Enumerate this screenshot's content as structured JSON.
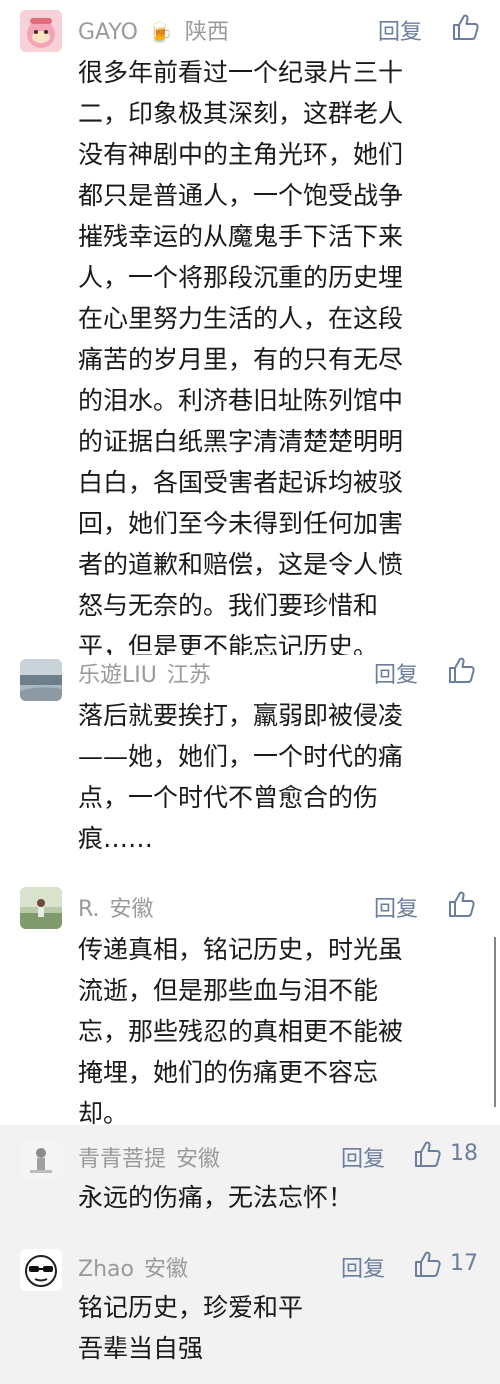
{
  "comments": [
    {
      "nickname": "GAYO",
      "badge": "🍺",
      "location": "陕西",
      "reply_label": "回复",
      "likes": "",
      "lines": [
        "很多年前看过一个纪录片三十",
        "二，印象极其深刻，这群老人",
        "没有神剧中的主角光环，她们",
        "都只是普通人，一个饱受战争",
        "摧残幸运的从魔鬼手下活下来",
        "人，一个将那段沉重的历史埋",
        "在心里努力生活的人，在这段",
        "痛苦的岁月里，有的只有无尽",
        "的泪水。利济巷旧址陈列馆中",
        "的证据白纸黑字清清楚楚明明",
        "白白，各国受害者起诉均被驳",
        "回，她们至今未得到任何加害",
        "者的道歉和赔偿，这是令人愤",
        "怒与无奈的。我们要珍惜和",
        "平，但是更不能忘记历史。"
      ]
    },
    {
      "nickname": "乐遊LIU",
      "location": "江苏",
      "reply_label": "回复",
      "likes": "",
      "lines": [
        "落后就要挨打，羸弱即被侵凌",
        "——她，她们，一个时代的痛",
        "点，一个时代不曾愈合的伤",
        "痕……"
      ]
    },
    {
      "nickname": "R.",
      "location": "安徽",
      "reply_label": "回复",
      "likes": "",
      "lines": [
        "传递真相，铭记历史，时光虽",
        "流逝，但是那些血与泪不能",
        "忘，那些残忍的真相更不能被",
        "掩埋，她们的伤痛更不容忘",
        "却。"
      ]
    },
    {
      "nickname": "青青菩提",
      "location": "安徽",
      "reply_label": "回复",
      "likes": "18",
      "lines": [
        "永远的伤痛，无法忘怀！"
      ]
    },
    {
      "nickname": "Zhao",
      "location": "安徽",
      "reply_label": "回复",
      "likes": "17",
      "lines": [
        "铭记历史，珍爱和平",
        "吾辈当自强"
      ]
    }
  ],
  "colors": {
    "meta": "#9a9a9a",
    "accent": "#6b7ea0",
    "text": "#1a1a1a",
    "panel_gray": "#f2f2f2"
  },
  "icons": {
    "like": "thumbs-up-outline-icon"
  }
}
